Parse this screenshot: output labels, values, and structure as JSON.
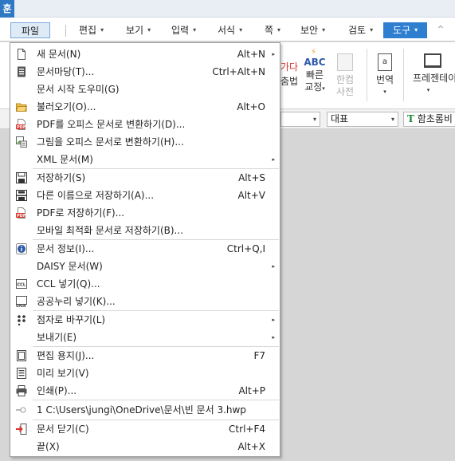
{
  "app": {
    "icon_glyph": "훈"
  },
  "menubar": {
    "items": [
      {
        "label": "파일",
        "has_arrow": false
      },
      {
        "label": "편집",
        "has_arrow": true
      },
      {
        "label": "보기",
        "has_arrow": true
      },
      {
        "label": "입력",
        "has_arrow": true
      },
      {
        "label": "서식",
        "has_arrow": true
      },
      {
        "label": "쪽",
        "has_arrow": true
      },
      {
        "label": "보안",
        "has_arrow": true
      },
      {
        "label": "검토",
        "has_arrow": true
      },
      {
        "label": "도구",
        "has_arrow": true
      }
    ],
    "arrow_glyph": "▾"
  },
  "ribbon": {
    "partial_label_1": "가다",
    "partial_label_2": "춤법",
    "spell_check": {
      "icon_text": "ABC",
      "line1": "빠른",
      "line2": "교정"
    },
    "hanja": {
      "line1": "한컴",
      "line2": "사전"
    },
    "translate": {
      "line1": "번역"
    },
    "presentation": {
      "line1": "프레젠테이"
    }
  },
  "format_bar": {
    "style_value": "대표",
    "font_value": "함초롬비"
  },
  "file_menu": {
    "items": [
      {
        "label": "새 문서(N)",
        "shortcut": "Alt+N",
        "submenu": true,
        "icon": "new-document-icon"
      },
      {
        "label": "문서마당(T)...",
        "shortcut": "Ctrl+Alt+N",
        "submenu": false,
        "icon": "template-icon"
      },
      {
        "label": "문서 시작 도우미(G)",
        "shortcut": "",
        "submenu": false,
        "icon": ""
      },
      {
        "label": "불러오기(O)...",
        "shortcut": "Alt+O",
        "submenu": false,
        "icon": "open-folder-icon"
      },
      {
        "label": "PDF를 오피스 문서로 변환하기(D)...",
        "shortcut": "",
        "submenu": false,
        "icon": "pdf-convert-icon"
      },
      {
        "label": "그림을 오피스 문서로 변환하기(H)...",
        "shortcut": "",
        "submenu": false,
        "icon": "image-convert-icon"
      },
      {
        "label": "XML 문서(M)",
        "shortcut": "",
        "submenu": true,
        "icon": ""
      },
      {
        "label": "저장하기(S)",
        "shortcut": "Alt+S",
        "submenu": false,
        "icon": "save-icon"
      },
      {
        "label": "다른 이름으로 저장하기(A)...",
        "shortcut": "Alt+V",
        "submenu": false,
        "icon": "save-as-icon"
      },
      {
        "label": "PDF로 저장하기(F)...",
        "shortcut": "",
        "submenu": false,
        "icon": "save-pdf-icon"
      },
      {
        "label": "모바일 최적화 문서로 저장하기(B)...",
        "shortcut": "",
        "submenu": false,
        "icon": ""
      },
      {
        "label": "문서 정보(I)...",
        "shortcut": "Ctrl+Q,I",
        "submenu": false,
        "icon": "info-icon"
      },
      {
        "label": "DAISY 문서(W)",
        "shortcut": "",
        "submenu": true,
        "icon": ""
      },
      {
        "label": "CCL 넣기(Q)...",
        "shortcut": "",
        "submenu": false,
        "icon": "ccl-icon"
      },
      {
        "label": "공공누리 넣기(K)...",
        "shortcut": "",
        "submenu": false,
        "icon": "kogl-icon"
      },
      {
        "label": "점자로 바꾸기(L)",
        "shortcut": "",
        "submenu": true,
        "icon": "braille-icon"
      },
      {
        "label": "보내기(E)",
        "shortcut": "",
        "submenu": true,
        "icon": ""
      },
      {
        "label": "편집 용지(J)...",
        "shortcut": "F7",
        "submenu": false,
        "icon": "page-setup-icon"
      },
      {
        "label": "미리 보기(V)",
        "shortcut": "",
        "submenu": false,
        "icon": "preview-icon"
      },
      {
        "label": "인쇄(P)...",
        "shortcut": "Alt+P",
        "submenu": false,
        "icon": "print-icon"
      },
      {
        "label": "1 C:\\Users\\jungi\\OneDrive\\문서\\빈 문서 3.hwp",
        "shortcut": "",
        "submenu": false,
        "icon": "pin-icon"
      },
      {
        "label": "문서 닫기(C)",
        "shortcut": "Ctrl+F4",
        "submenu": false,
        "icon": "close-document-icon"
      },
      {
        "label": "끝(X)",
        "shortcut": "Alt+X",
        "submenu": false,
        "icon": ""
      }
    ],
    "submenu_glyph": "▸"
  },
  "colors": {
    "accent": "#2f7fd1",
    "pdf_red": "#d9342b",
    "menu_border": "#9b9b9b"
  }
}
